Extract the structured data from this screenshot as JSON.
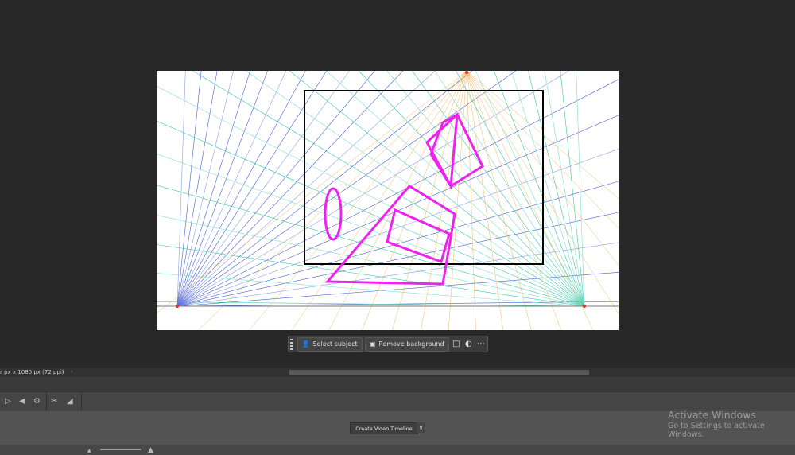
{
  "context_bar": {
    "select_subject": "Select subject",
    "remove_background": "Remove background",
    "icons": [
      "person-icon",
      "image-icon",
      "crop-transform-icon",
      "adjustment-icon",
      "more-icon"
    ]
  },
  "status_bar": {
    "doc_info": "r px x 1080 px (72 ppi)",
    "arrow_right": "›",
    "arrow_left": "‹"
  },
  "timeline": {
    "create_label": "Create Video Timeline",
    "tools": [
      "step-forward-icon",
      "play-back-icon",
      "settings-icon",
      "scissors-icon",
      "transition-icon"
    ]
  },
  "watermark": {
    "title": "Activate Windows",
    "subtitle": "Go to Settings to activate Windows."
  },
  "colors": {
    "magenta": "#ee22ee",
    "background": "#282828"
  }
}
